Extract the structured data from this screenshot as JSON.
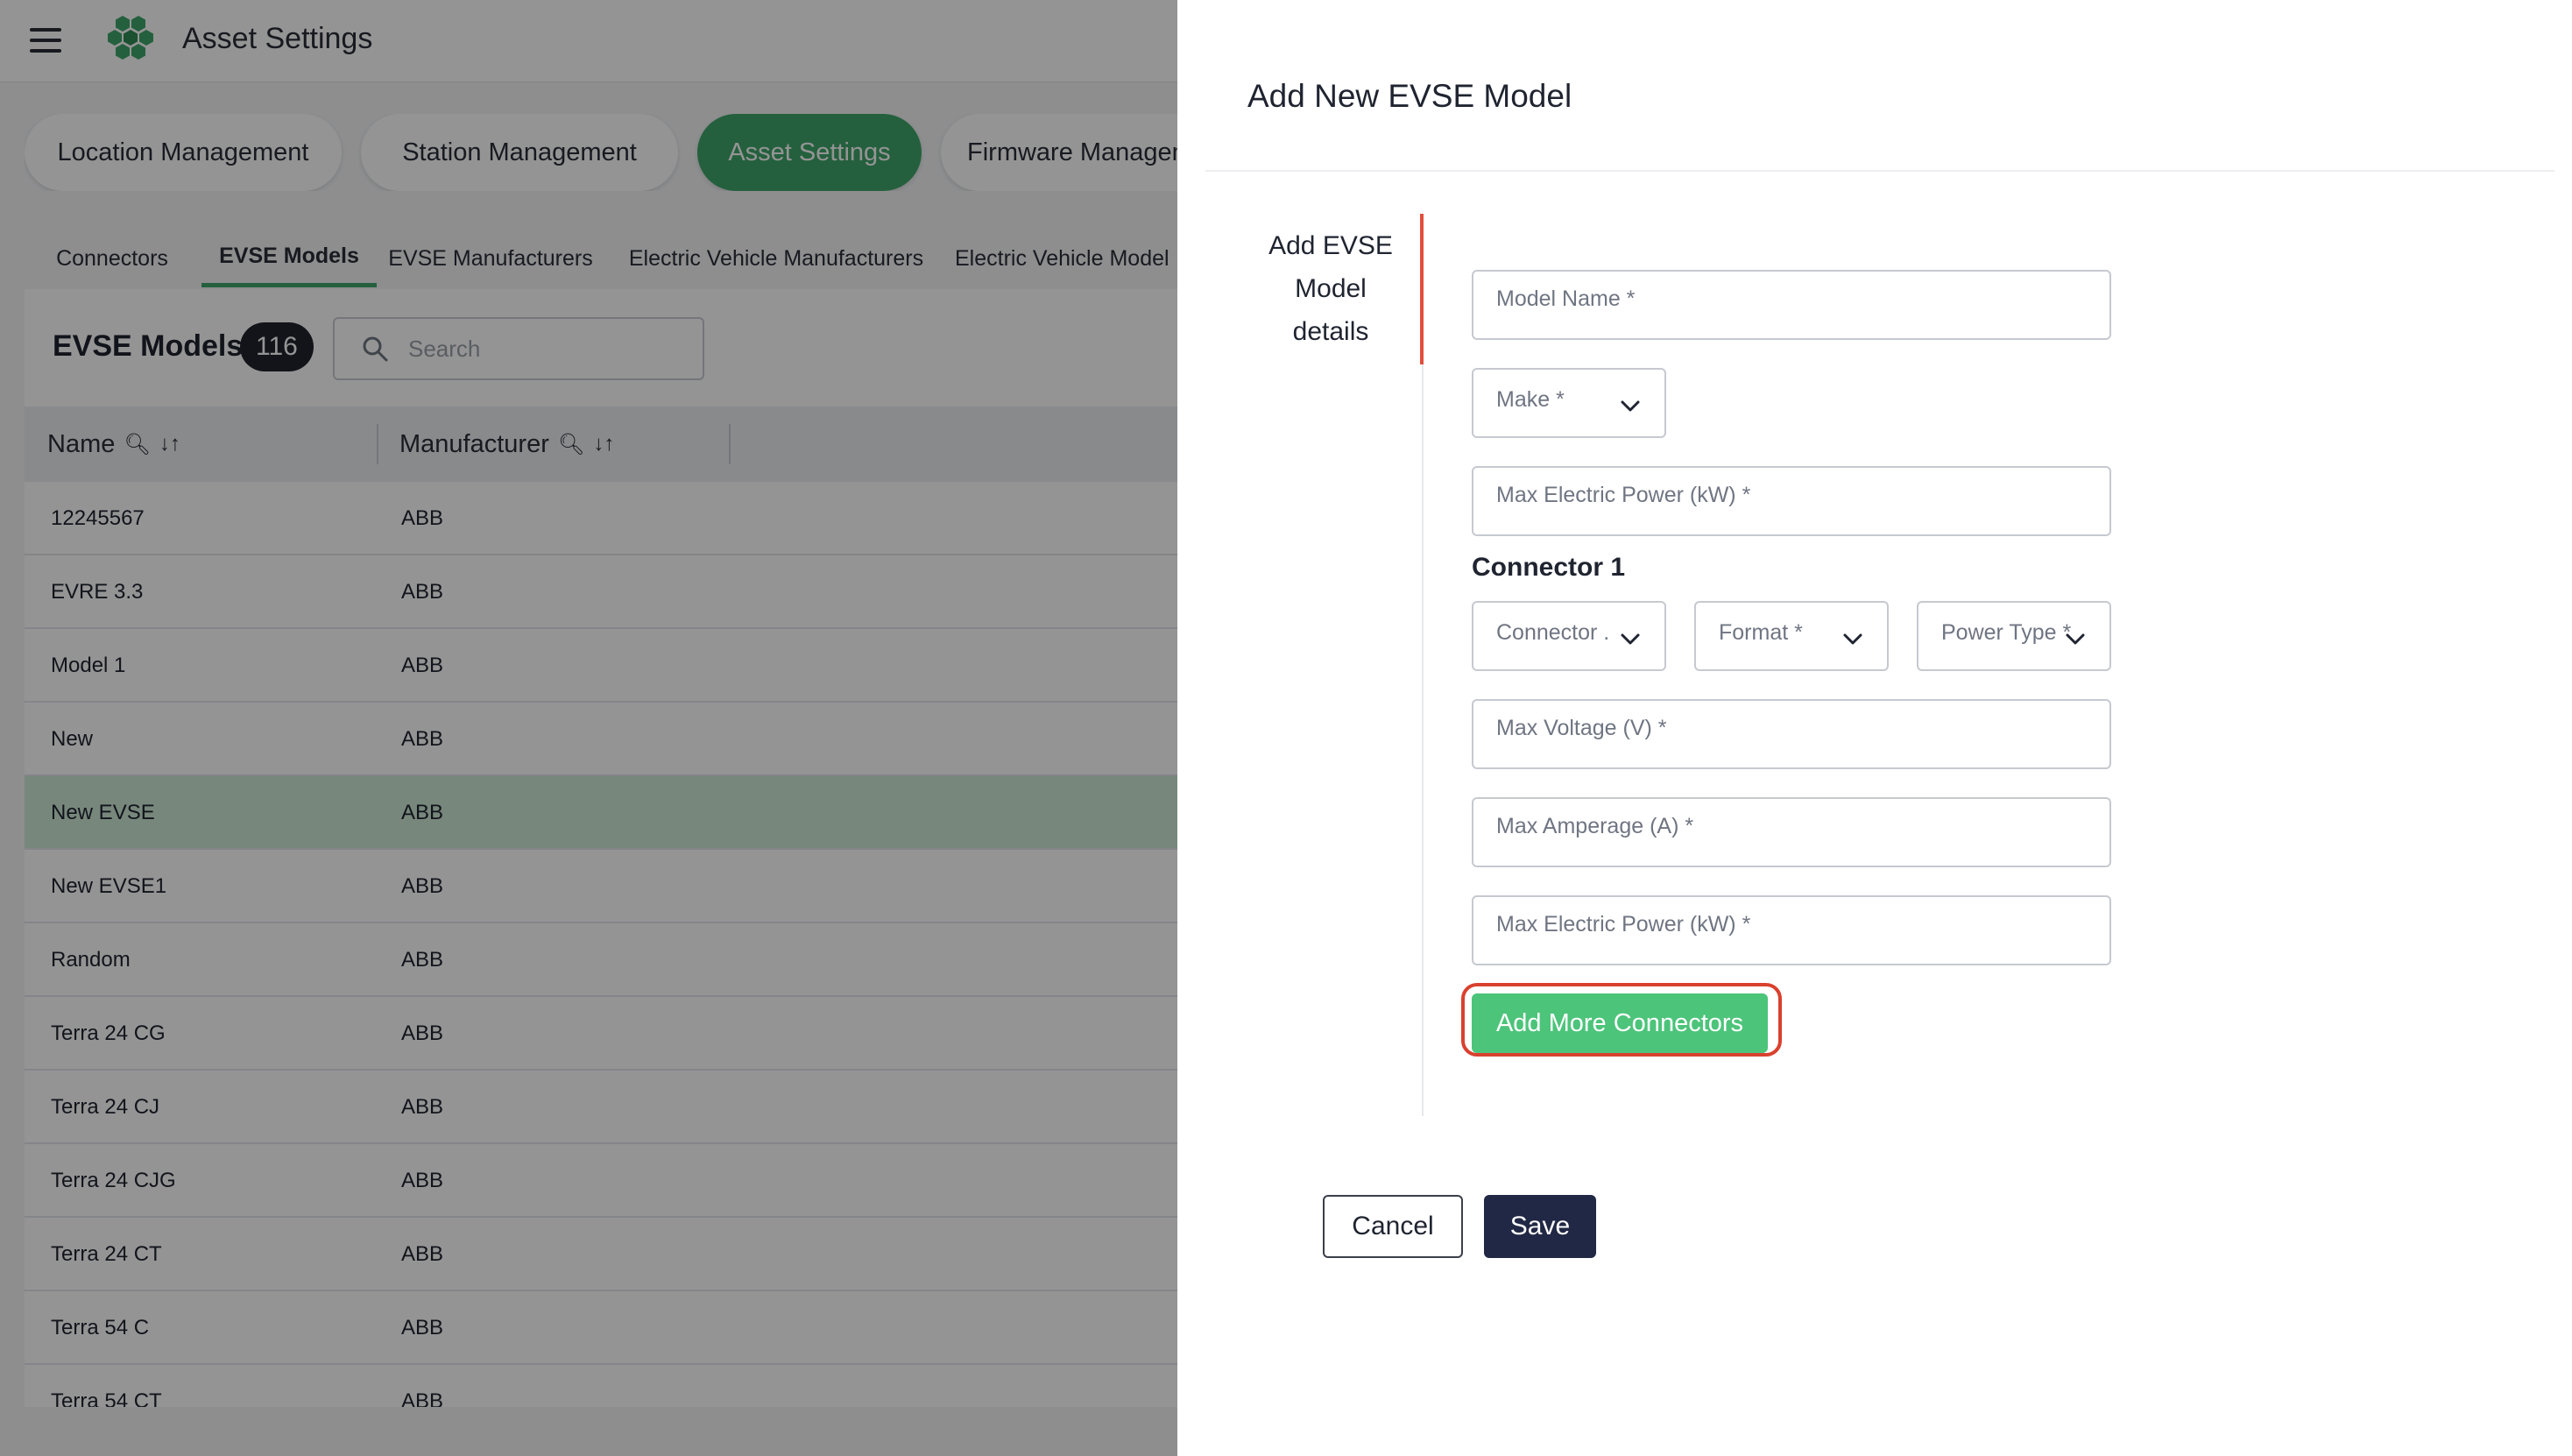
{
  "app": {
    "title": "Asset Settings",
    "brand_color": "#3ea66a"
  },
  "nav": {
    "pills": [
      {
        "label": "Location Management"
      },
      {
        "label": "Station Management"
      },
      {
        "label": "Asset Settings"
      },
      {
        "label": "Firmware Manageme"
      }
    ],
    "active_pill": "Asset Settings"
  },
  "subtabs": [
    {
      "label": "Connectors"
    },
    {
      "label": "EVSE Models"
    },
    {
      "label": "EVSE Manufacturers"
    },
    {
      "label": "Electric Vehicle Manufacturers"
    },
    {
      "label": "Electric Vehicle Model"
    }
  ],
  "list": {
    "title": "EVSE Models",
    "count": "116",
    "search_placeholder": "Search",
    "columns": [
      {
        "label": "Name"
      },
      {
        "label": "Manufacturer"
      }
    ],
    "rows": [
      {
        "name": "12245567",
        "manufacturer": "ABB"
      },
      {
        "name": "EVRE 3.3",
        "manufacturer": "ABB"
      },
      {
        "name": "Model 1",
        "manufacturer": "ABB"
      },
      {
        "name": "New",
        "manufacturer": "ABB"
      },
      {
        "name": "New EVSE",
        "manufacturer": "ABB"
      },
      {
        "name": "New EVSE1",
        "manufacturer": "ABB"
      },
      {
        "name": "Random",
        "manufacturer": "ABB"
      },
      {
        "name": "Terra 24 CG",
        "manufacturer": "ABB"
      },
      {
        "name": "Terra 24 CJ",
        "manufacturer": "ABB"
      },
      {
        "name": "Terra 24 CJG",
        "manufacturer": "ABB"
      },
      {
        "name": "Terra 24 CT",
        "manufacturer": "ABB"
      },
      {
        "name": "Terra 54 C",
        "manufacturer": "ABB"
      },
      {
        "name": "Terra 54 CT",
        "manufacturer": "ABB"
      }
    ],
    "selected_row": "New EVSE"
  },
  "drawer": {
    "title": "Add New EVSE Model",
    "step_label_line1": "Add EVSE",
    "step_label_line2": "Model",
    "step_label_line3": "details",
    "fields": {
      "model_name": {
        "placeholder": "Model Name *",
        "value": ""
      },
      "make": {
        "placeholder": "Make *",
        "value": ""
      },
      "max_power": {
        "placeholder": "Max Electric Power (kW) *",
        "value": ""
      }
    },
    "connector": {
      "title": "Connector 1",
      "connector_type": {
        "placeholder": "Connector ..."
      },
      "format": {
        "placeholder": "Format *"
      },
      "power_type": {
        "placeholder": "Power Type *"
      },
      "max_voltage": {
        "placeholder": "Max Voltage (V) *",
        "value": ""
      },
      "max_amperage": {
        "placeholder": "Max Amperage (A) *",
        "value": ""
      },
      "max_power": {
        "placeholder": "Max Electric Power (kW) *",
        "value": ""
      }
    },
    "add_connectors_label": "Add More Connectors",
    "cancel_label": "Cancel",
    "save_label": "Save"
  },
  "icons": {
    "menu": "hamburger-icon",
    "logo": "hexagon-cluster-logo",
    "search": "search-icon",
    "column_search": "magnifier-icon",
    "sort": "sort-icon",
    "dropdown": "chevron-down-icon"
  }
}
